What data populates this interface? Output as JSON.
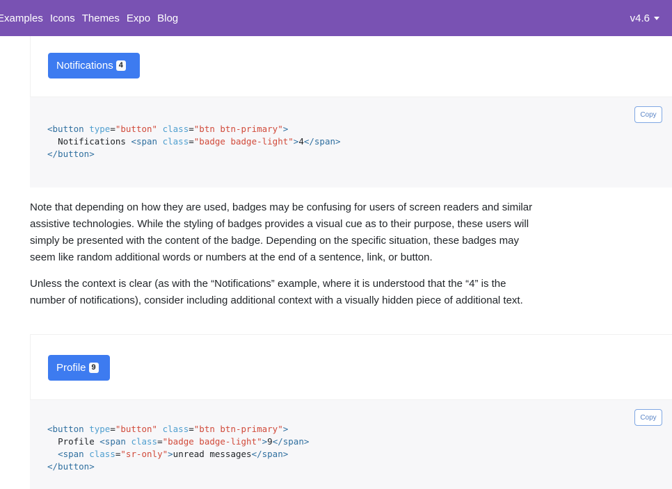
{
  "nav": {
    "links": [
      "Examples",
      "Icons",
      "Themes",
      "Expo",
      "Blog"
    ],
    "version": "v4.6"
  },
  "example1": {
    "button_label": "Notifications",
    "badge": "4",
    "copy_label": "Copy",
    "code": {
      "l1_tag_open": "<button",
      "l1_attr1": "type",
      "l1_str1": "\"button\"",
      "l1_attr2": "class",
      "l1_str2": "\"btn btn-primary\"",
      "l1_close": ">",
      "l2_text": "Notifications",
      "l2_tag_open": "<span",
      "l2_attr": "class",
      "l2_str": "\"badge badge-light\"",
      "l2_gt": ">",
      "l2_value": "4",
      "l2_tag_close": "</span>",
      "l3_tag_close": "</button>"
    }
  },
  "paragraphs": [
    "Note that depending on how they are used, badges may be confusing for users of screen readers and similar assistive technologies. While the styling of badges provides a visual cue as to their purpose, these users will simply be presented with the content of the badge. Depending on the specific situation, these badges may seem like random additional words or numbers at the end of a sentence, link, or button.",
    "Unless the context is clear (as with the “Notifications” example, where it is understood that the “4” is the number of notifications), consider including additional context with a visually hidden piece of additional text."
  ],
  "example2": {
    "button_label": "Profile",
    "badge": "9",
    "copy_label": "Copy",
    "code": {
      "l1_tag_open": "<button",
      "l1_attr1": "type",
      "l1_str1": "\"button\"",
      "l1_attr2": "class",
      "l1_str2": "\"btn btn-primary\"",
      "l1_close": ">",
      "l2_text": "Profile",
      "l2_tag_open": "<span",
      "l2_attr": "class",
      "l2_str": "\"badge badge-light\"",
      "l2_gt": ">",
      "l2_value": "9",
      "l2_tag_close": "</span>",
      "l3_tag_open": "<span",
      "l3_attr": "class",
      "l3_str": "\"sr-only\"",
      "l3_gt": ">",
      "l3_text": "unread messages",
      "l3_tag_close": "</span>",
      "l4_tag_close": "</button>"
    }
  },
  "colors": {
    "navbar": "#7952b3",
    "primary": "#3d7bf0",
    "code_bg": "#f7f7f9"
  }
}
